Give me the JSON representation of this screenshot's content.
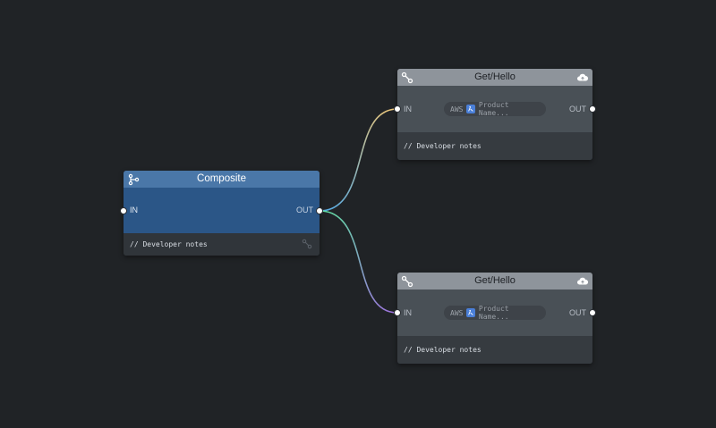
{
  "canvas": {
    "background": "#202326"
  },
  "nodes": {
    "composite": {
      "title": "Composite",
      "in_label": "IN",
      "out_label": "OUT",
      "notes": "// Developer notes",
      "header_color": "#4a77a8",
      "body_color": "#2b5687",
      "header_icon": "branch-icon",
      "footer_icon": "link-icon"
    },
    "gethello_1": {
      "title": "Get/Hello",
      "in_label": "IN",
      "out_label": "OUT",
      "provider": "AWS",
      "placeholder": "Product Name...",
      "notes": "// Developer notes",
      "header_icon": "link-icon",
      "right_icon": "cloud-upload-icon"
    },
    "gethello_2": {
      "title": "Get/Hello",
      "in_label": "IN",
      "out_label": "OUT",
      "provider": "AWS",
      "placeholder": "Product Name...",
      "notes": "// Developer notes",
      "header_icon": "link-icon",
      "right_icon": "cloud-upload-icon"
    }
  },
  "wires": [
    {
      "from": "composite.out",
      "to": "gethello_1.in",
      "gradient": [
        "#4fa8e8",
        "#f0c674"
      ]
    },
    {
      "from": "composite.out",
      "to": "gethello_2.in",
      "gradient": [
        "#5fe0a0",
        "#a070e0"
      ]
    }
  ]
}
